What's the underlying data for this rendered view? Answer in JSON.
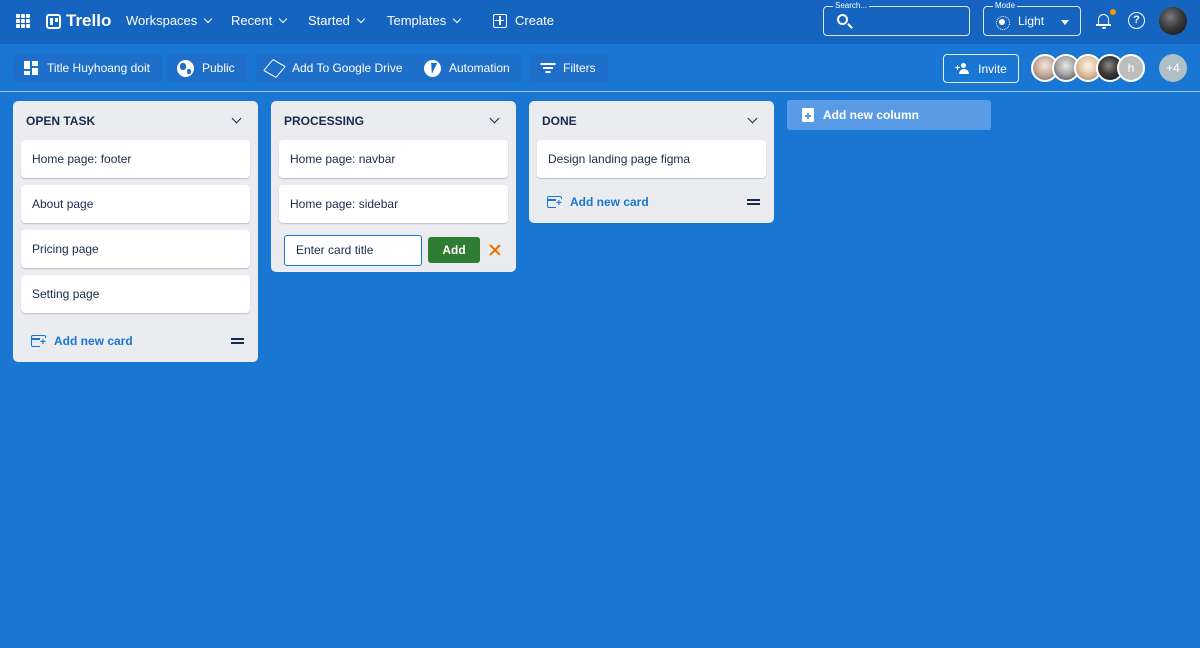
{
  "topbar": {
    "brand": "Trello",
    "nav": [
      {
        "label": "Workspaces"
      },
      {
        "label": "Recent"
      },
      {
        "label": "Started"
      },
      {
        "label": "Templates"
      }
    ],
    "create_label": "Create",
    "search": {
      "legend": "Search...",
      "value": ""
    },
    "mode": {
      "legend": "Mode",
      "value": "Light"
    },
    "notification_dot_color": "#ff9800"
  },
  "boardbar": {
    "title_chip": "Title Huyhoang doit",
    "visibility": "Public",
    "drive": "Add To Google Drive",
    "automation": "Automation",
    "filters": "Filters",
    "invite": "Invite",
    "members": {
      "initial": "h",
      "more": "+4"
    }
  },
  "columns": [
    {
      "title": "OPEN TASK",
      "cards": [
        "Home page: footer",
        "About page",
        "Pricing page",
        "Setting page"
      ],
      "add_label": "Add new card"
    },
    {
      "title": "PROCESSING",
      "cards": [
        "Home page: navbar",
        "Home page: sidebar"
      ],
      "form": {
        "placeholder": "Enter card title",
        "add_label": "Add"
      }
    },
    {
      "title": "DONE",
      "cards": [
        "Design landing page figma"
      ],
      "add_label": "Add new card"
    }
  ],
  "add_column_label": "Add new column",
  "colors": {
    "background": "#1976d2",
    "appbar": "#1565c0",
    "column": "#ebecf0",
    "add_button": "#2e7d32",
    "close_icon": "#ef6c00"
  }
}
